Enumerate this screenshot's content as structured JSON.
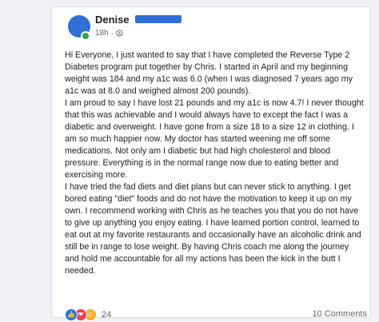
{
  "post": {
    "author": "Denise",
    "time": "18h",
    "separator": "·",
    "visibility_icon": "friends-icon",
    "paragraphs": [
      "Hi Everyone, I just wanted to say that I have completed the Reverse Type 2 Diabetes program put together by Chris. I started in April and my beginning weight was 184 and my a1c was 6.0 (when I was diagnosed 7 years ago my a1c was at 8.0 and weighed almost 200 pounds).",
      "I am proud to say I have lost 21 pounds and my a1c is now 4.7! I never thought that this was achievable and I would always have to except the fact I was a diabetic and overweight. I have gone from a size 18 to a size 12 in clothing. I am so much happier now. My doctor has started weening me off some medications. Not only am I diabetic but had high cholesterol and blood pressure. Everything is in the normal range now due to eating better and exercising more.",
      "I have tried the fad diets and diet plans but can never stick to anything.  I get bored eating \"diet\" foods and do not have the motivation to keep it up on my own. I recommend working with Chris as he teaches you that you do not have to give up anything you enjoy eating. I have learned portion control, learned to eat out at my favorite restaurants and occasionally have an alcoholic drink and still be in range to lose weight. By having Chris coach me along the journey and hold me accountable for all my actions has been the kick in the butt I needed."
    ],
    "reactions": {
      "icons": [
        "like-icon",
        "love-icon",
        "care-icon"
      ],
      "count": "24"
    },
    "comments": "10 Comments"
  },
  "colors": {
    "brand_blue": "#1877f2",
    "love_red": "#f33e58",
    "care_yellow": "#f7b125",
    "online_green": "#31a24c"
  }
}
